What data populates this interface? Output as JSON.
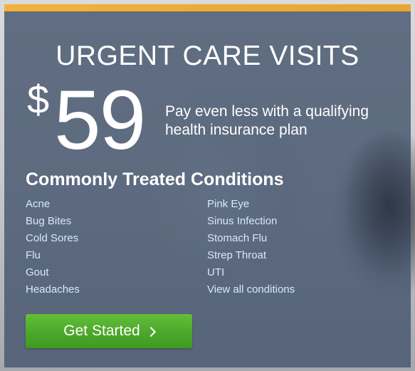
{
  "card": {
    "title": "URGENT CARE VISITS",
    "price": {
      "currency": "$",
      "amount": "59"
    },
    "tagline": "Pay even less with a qualifying health insurance plan",
    "conditions_heading": "Commonly Treated Conditions",
    "conditions_left": [
      "Acne",
      "Bug Bites",
      "Cold Sores",
      "Flu",
      "Gout",
      "Headaches"
    ],
    "conditions_right": [
      "Pink Eye",
      "Sinus Infection",
      "Stomach Flu",
      "Strep Throat",
      "UTI",
      "View all conditions"
    ],
    "cta_label": "Get Started"
  },
  "colors": {
    "accent_bar": "#f3b23a",
    "card_overlay": "#46566e",
    "cta_green": "#4ca82b",
    "link": "#d7e9ff"
  },
  "icons": {
    "cta": "chevron-right-icon"
  }
}
